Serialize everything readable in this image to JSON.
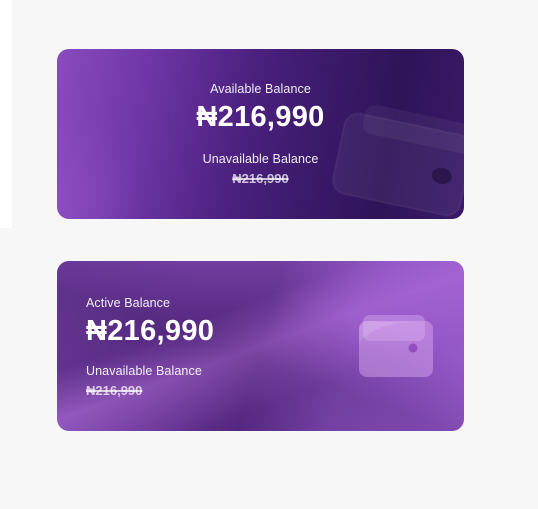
{
  "card1": {
    "available_label": "Available Balance",
    "available_amount": "₦216,990",
    "unavailable_label": "Unavailable Balance",
    "unavailable_amount": "₦216,990"
  },
  "card2": {
    "active_label": "Active Balance",
    "active_amount": "₦216,990",
    "unavailable_label": "Unavailable Balance",
    "unavailable_amount": "₦216,990"
  },
  "icons": {
    "card1_icon": "wallet-icon",
    "card2_icon": "wallet-icon"
  },
  "colors": {
    "card1_dark": "#2f1459",
    "card1_light": "#8a4bbf",
    "card2_base": "#5a2c86",
    "card2_highlight": "#9358c7",
    "page_bg": "#f7f7f7"
  }
}
